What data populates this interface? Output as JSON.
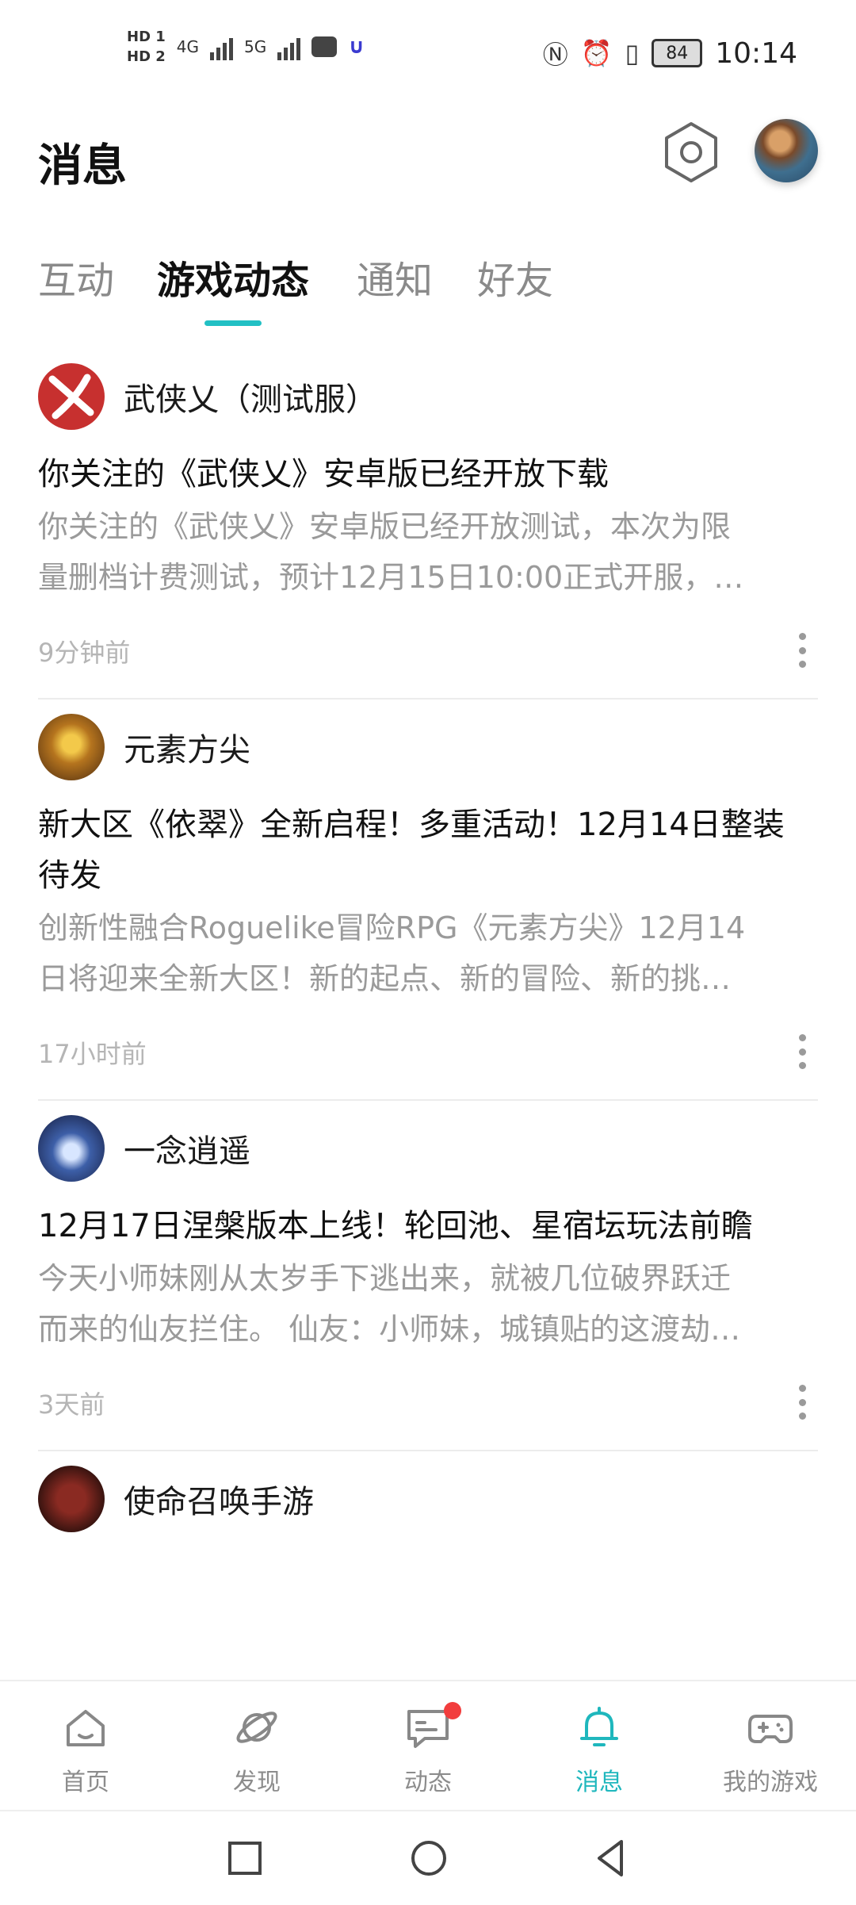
{
  "status_bar": {
    "hd1": "HD 1",
    "hd2": "HD 2",
    "net1": "4G",
    "net2": "5G",
    "battery": "84",
    "time": "10:14"
  },
  "header": {
    "title": "消息"
  },
  "tabs": [
    {
      "label": "互动",
      "active": false
    },
    {
      "label": "游戏动态",
      "active": true
    },
    {
      "label": "通知",
      "active": false
    },
    {
      "label": "好友",
      "active": false
    }
  ],
  "feed": [
    {
      "game": "武侠乂（测试服）",
      "title": "你关注的《武侠乂》安卓版已经开放下载",
      "desc_line1": "你关注的《武侠乂》安卓版已经开放测试，本次为限",
      "desc_line2": "量删档计费测试，预计12月15日10:00正式开服，…",
      "time": "9分钟前"
    },
    {
      "game": "元素方尖",
      "title_line1": "新大区《依翠》全新启程！多重活动！12月14日整装",
      "title_line2": "待发",
      "desc_line1": "创新性融合Roguelike冒险RPG《元素方尖》12月14",
      "desc_line2": "日将迎来全新大区！新的起点、新的冒险、新的挑…",
      "time": "17小时前"
    },
    {
      "game": "一念逍遥",
      "title": "12月17日涅槃版本上线！轮回池、星宿坛玩法前瞻",
      "desc_line1": "今天小师妹刚从太岁手下逃出来，就被几位破界跃迁",
      "desc_line2": "而来的仙友拦住。 仙友：小师妹，城镇贴的这渡劫…",
      "time": "3天前"
    },
    {
      "game": "使命召唤手游"
    }
  ],
  "bottom_nav": [
    {
      "label": "首页",
      "icon": "home-icon",
      "active": false
    },
    {
      "label": "发现",
      "icon": "planet-icon",
      "active": false
    },
    {
      "label": "动态",
      "icon": "chat-icon",
      "active": false,
      "badge": true
    },
    {
      "label": "消息",
      "icon": "bell-icon",
      "active": true
    },
    {
      "label": "我的游戏",
      "icon": "gamepad-icon",
      "active": false
    }
  ],
  "colors": {
    "accent": "#1fb7bd",
    "badge": "#f23d3d",
    "muted_text": "#9a9a9a"
  }
}
